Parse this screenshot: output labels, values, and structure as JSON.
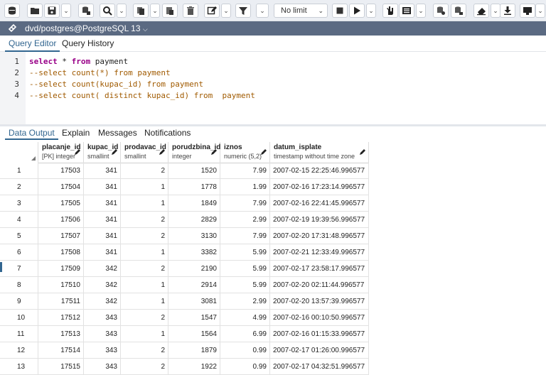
{
  "toolbar": {
    "limit_value": "No limit",
    "buttons": [
      "database-icon",
      "folder-open-icon",
      "save-icon",
      "save-options-chevron",
      "save-data-icon",
      "search-icon",
      "search-options-chevron",
      "copy-icon",
      "copy-options-chevron",
      "paste-rows-icon",
      "delete-icon",
      "edit-icon",
      "edit-options-chevron",
      "filter-icon",
      "filter-options-chevron",
      "stop-icon",
      "execute-icon",
      "execute-options-chevron",
      "explain-icon",
      "explain-analyze-icon",
      "explain-options-chevron",
      "commit-icon",
      "rollback-icon",
      "clear-icon",
      "clear-options-chevron",
      "download-icon",
      "macros-icon",
      "macros-options-chevron"
    ]
  },
  "connection": {
    "label": "dvd/postgres@PostgreSQL 13"
  },
  "editor_tabs": [
    "Query Editor",
    "Query History"
  ],
  "editor": {
    "lines": [
      {
        "no": "1",
        "kw1": "select",
        "mid": " * ",
        "kw2": "from",
        "rest": " payment"
      },
      {
        "no": "2",
        "comment": "--select count(*) from payment"
      },
      {
        "no": "3",
        "comment": "--select count(kupac_id) from payment"
      },
      {
        "no": "4",
        "comment": "--select count( distinct kupac_id) from  payment"
      }
    ]
  },
  "output_tabs": [
    "Data Output",
    "Explain",
    "Messages",
    "Notifications"
  ],
  "grid": {
    "columns": [
      {
        "name": "placanje_id",
        "type": "[PK] integer"
      },
      {
        "name": "kupac_id",
        "type": "smallint"
      },
      {
        "name": "prodavac_id",
        "type": "smallint"
      },
      {
        "name": "porudzbina_id",
        "type": "integer"
      },
      {
        "name": "iznos",
        "type": "numeric (5,2)"
      },
      {
        "name": "datum_isplate",
        "type": "timestamp without time zone"
      }
    ],
    "rows": [
      [
        "1",
        "17503",
        "341",
        "2",
        "1520",
        "7.99",
        "2007-02-15 22:25:46.996577"
      ],
      [
        "2",
        "17504",
        "341",
        "1",
        "1778",
        "1.99",
        "2007-02-16 17:23:14.996577"
      ],
      [
        "3",
        "17505",
        "341",
        "1",
        "1849",
        "7.99",
        "2007-02-16 22:41:45.996577"
      ],
      [
        "4",
        "17506",
        "341",
        "2",
        "2829",
        "2.99",
        "2007-02-19 19:39:56.996577"
      ],
      [
        "5",
        "17507",
        "341",
        "2",
        "3130",
        "7.99",
        "2007-02-20 17:31:48.996577"
      ],
      [
        "6",
        "17508",
        "341",
        "1",
        "3382",
        "5.99",
        "2007-02-21 12:33:49.996577"
      ],
      [
        "7",
        "17509",
        "342",
        "2",
        "2190",
        "5.99",
        "2007-02-17 23:58:17.996577"
      ],
      [
        "8",
        "17510",
        "342",
        "1",
        "2914",
        "5.99",
        "2007-02-20 02:11:44.996577"
      ],
      [
        "9",
        "17511",
        "342",
        "1",
        "3081",
        "2.99",
        "2007-02-20 13:57:39.996577"
      ],
      [
        "10",
        "17512",
        "343",
        "2",
        "1547",
        "4.99",
        "2007-02-16 00:10:50.996577"
      ],
      [
        "11",
        "17513",
        "343",
        "1",
        "1564",
        "6.99",
        "2007-02-16 01:15:33.996577"
      ],
      [
        "12",
        "17514",
        "343",
        "2",
        "1879",
        "0.99",
        "2007-02-17 01:26:00.996577"
      ],
      [
        "13",
        "17515",
        "343",
        "2",
        "1922",
        "0.99",
        "2007-02-17 04:32:51.996577"
      ]
    ]
  }
}
